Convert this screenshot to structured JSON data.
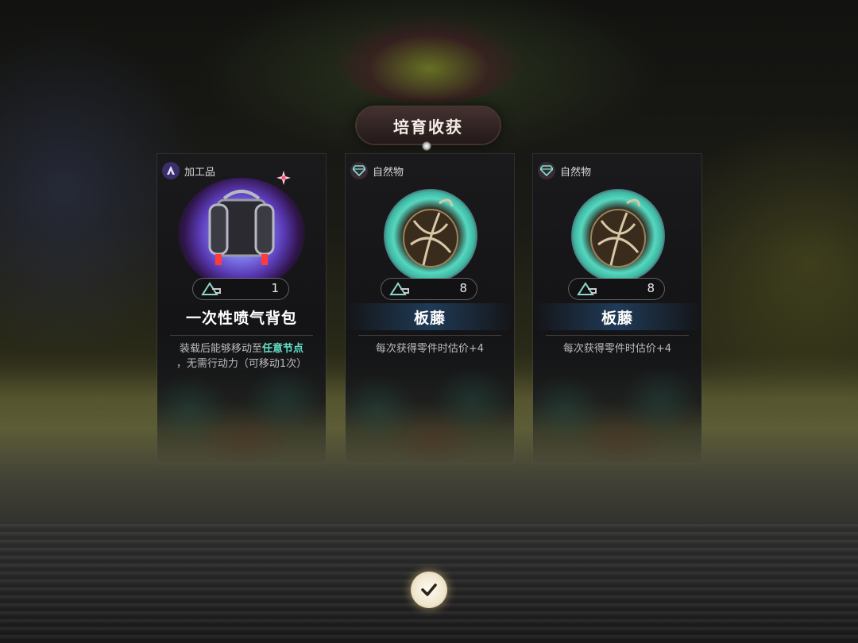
{
  "header": {
    "title": "培育收获"
  },
  "cards": [
    {
      "category": "加工品",
      "category_icon": "processed-goods-icon",
      "item_icon": "jetpack-icon",
      "quantity": "1",
      "name": "一次性喷气背包",
      "desc_line1_prefix": "装载后能够移动至",
      "desc_highlight": "任意节点",
      "desc_line2": "，无需行动力（可移动1次）"
    },
    {
      "category": "自然物",
      "category_icon": "natural-gem-icon",
      "item_icon": "vine-icon",
      "quantity": "8",
      "name": "板藤",
      "desc": "每次获得零件时估价+4"
    },
    {
      "category": "自然物",
      "category_icon": "natural-gem-icon",
      "item_icon": "vine-icon",
      "quantity": "8",
      "name": "板藤",
      "desc": "每次获得零件时估价+4"
    }
  ],
  "colors": {
    "highlight": "#63e0c8",
    "processed_badge": "#3a2f6a",
    "natural_badge": "#3a2a34"
  },
  "confirm_icon": "checkmark-icon"
}
